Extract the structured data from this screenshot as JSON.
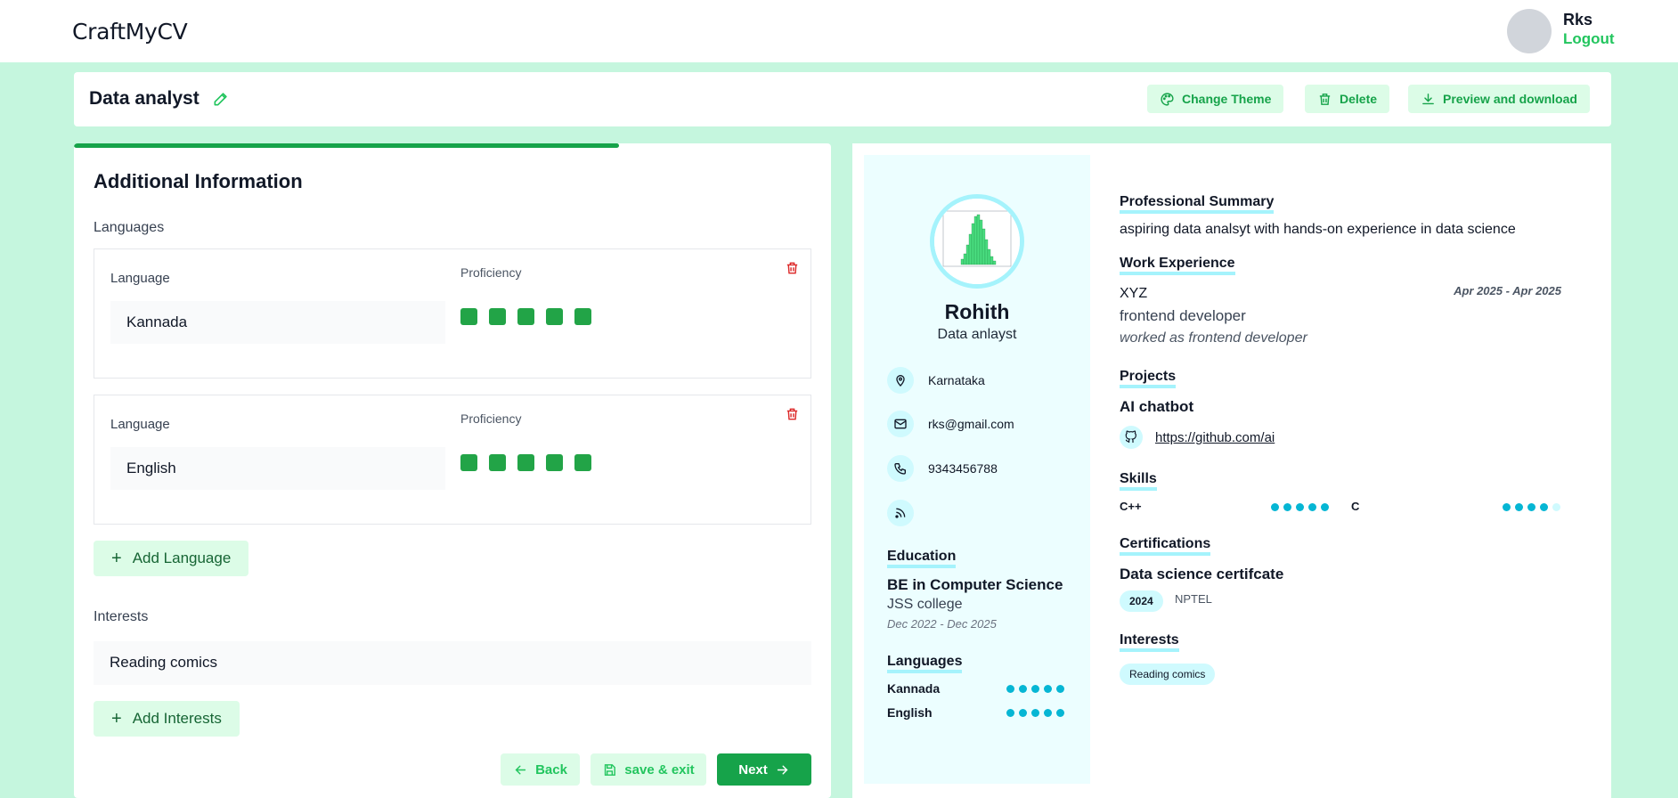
{
  "app": {
    "brand": "CraftMyCV",
    "user_name": "Rks",
    "logout_label": "Logout"
  },
  "titlebar": {
    "title": "Data analyst",
    "change_theme_label": "Change Theme",
    "delete_label": "Delete",
    "preview_label": "Preview and download"
  },
  "form": {
    "progress": 0.72,
    "section_title": "Additional Information",
    "languages_label": "Languages",
    "language_field_label": "Language",
    "proficiency_label": "Proficiency",
    "languages": [
      {
        "value": "Kannada",
        "level": 5
      },
      {
        "value": "English",
        "level": 5
      }
    ],
    "add_language_label": "Add Language",
    "interests_label": "Interests",
    "interest_value": "Reading comics",
    "add_interests_label": "Add Interests",
    "back_label": "Back",
    "save_exit_label": "save & exit",
    "next_label": "Next"
  },
  "preview": {
    "name": "Rohith",
    "role": "Data anlayst",
    "location": "Karnataka",
    "email": "rks@gmail.com",
    "phone": "9343456788",
    "education_heading": "Education",
    "degree": "BE in Computer Science",
    "college": "JSS college",
    "edu_dates": "Dec 2022 - Dec 2025",
    "languages_heading": "Languages",
    "languages": [
      {
        "name": "Kannada",
        "level": 5
      },
      {
        "name": "English",
        "level": 5
      }
    ],
    "summary_heading": "Professional Summary",
    "summary": "aspiring data analsyt with hands-on experience in data science",
    "work_heading": "Work Experience",
    "company": "XYZ",
    "work_dates": "Apr 2025 - Apr 2025",
    "job_title": "frontend developer",
    "job_desc": "worked as frontend developer",
    "projects_heading": "Projects",
    "project_name": "AI chatbot",
    "project_link": "https://github.com/ai",
    "skills_heading": "Skills",
    "skills": [
      {
        "name": "C++",
        "level": 5
      },
      {
        "name": "C",
        "level": 4
      }
    ],
    "certs_heading": "Certifications",
    "cert_name": "Data science certifcate",
    "cert_year": "2024",
    "cert_issuer": "NPTEL",
    "interests_heading": "Interests",
    "interest": "Reading comics"
  },
  "colors": {
    "accent": "#22c55e",
    "page_bg": "#c5f6de",
    "resume_accent": "#06b6d4"
  }
}
